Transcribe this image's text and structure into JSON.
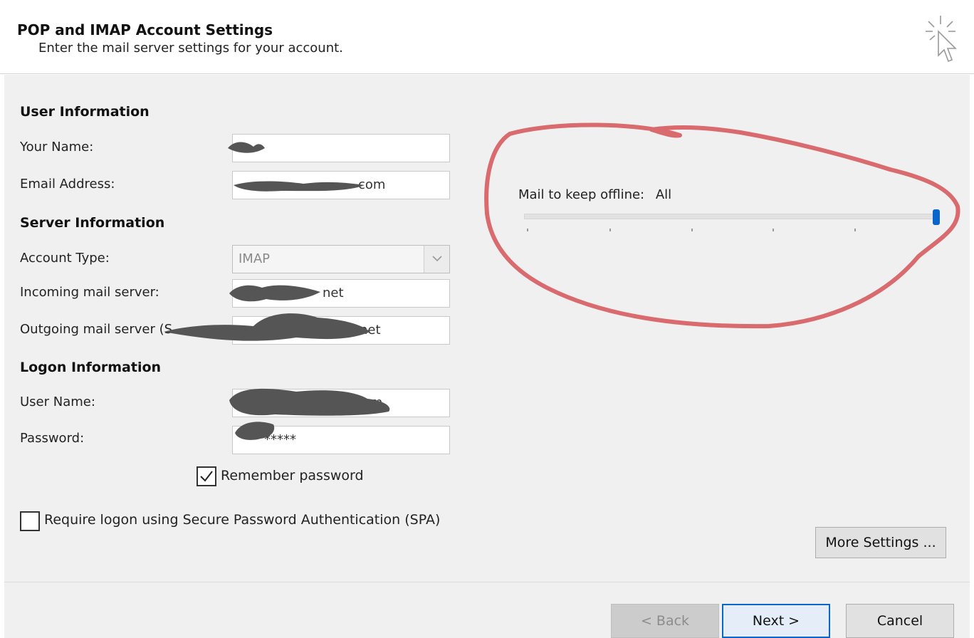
{
  "header": {
    "title": "POP and IMAP Account Settings",
    "subtitle": "Enter the mail server settings for your account."
  },
  "user_info": {
    "section_title": "User Information",
    "name_label": "Your Name:",
    "name_value": "",
    "email_label": "Email Address:",
    "email_value": "com"
  },
  "server_info": {
    "section_title": "Server Information",
    "account_type_label": "Account Type:",
    "account_type_value": "IMAP",
    "incoming_label": "Incoming mail server:",
    "incoming_value": "net",
    "outgoing_label": "Outgoing mail server (S",
    "outgoing_value": "net"
  },
  "logon_info": {
    "section_title": "Logon Information",
    "username_label": "User Name:",
    "username_value": "com",
    "password_label": "Password:",
    "password_value": "*****"
  },
  "remember_password": {
    "label": "Remember password",
    "checked": true
  },
  "spa": {
    "label": "Require logon using Secure Password Authentication (SPA)",
    "checked": false
  },
  "offline": {
    "label": "Mail to keep offline:",
    "value": "All"
  },
  "buttons": {
    "more_settings": "More Settings ...",
    "back": "< Back",
    "next": "Next >",
    "cancel": "Cancel"
  },
  "colors": {
    "accent": "#0a66c8",
    "annotation": "#d96a6e",
    "redaction": "#555555"
  }
}
